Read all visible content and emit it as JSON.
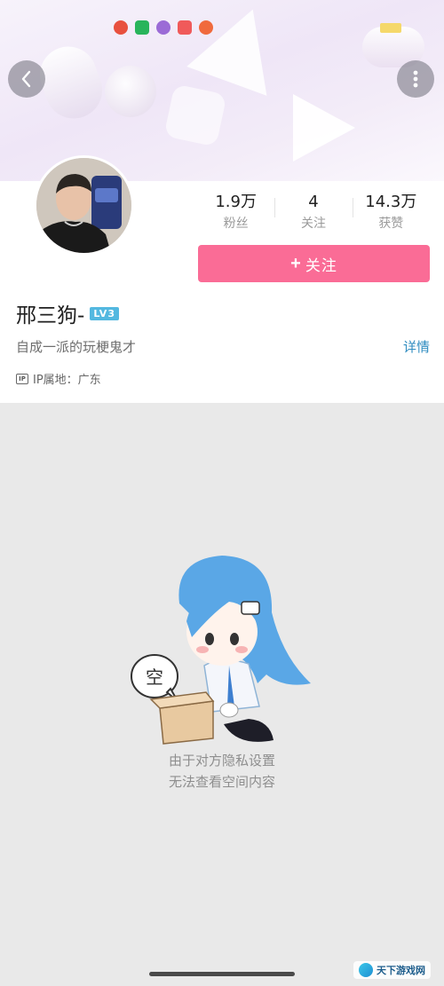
{
  "header": {
    "back_icon": "chevron-left-icon",
    "more_icon": "vertical-dots-icon"
  },
  "status_bar": {
    "icons": [
      "red-play-icon",
      "green-bag-icon",
      "purple-app-icon",
      "music-icon",
      "search-icon"
    ],
    "colors": [
      "#e8503e",
      "#29b45b",
      "#9b6bd6",
      "#f05a5a",
      "#f06a3d"
    ]
  },
  "profile": {
    "username": "邢三狗-",
    "level": "LV3",
    "bio": "自成一派的玩梗鬼才",
    "detail_label": "详情",
    "ip_badge": "IP",
    "ip_location": "IP属地：广东"
  },
  "stats": [
    {
      "value": "1.9万",
      "label": "粉丝"
    },
    {
      "value": "4",
      "label": "关注"
    },
    {
      "value": "14.3万",
      "label": "获赞"
    }
  ],
  "follow_button": {
    "icon": "+",
    "label": "关注",
    "color": "#fa6c96"
  },
  "empty_state": {
    "badge_text": "空",
    "line1": "由于对方隐私设置",
    "line2": "无法查看空间内容"
  },
  "watermark": {
    "text": "天下游戏网"
  }
}
